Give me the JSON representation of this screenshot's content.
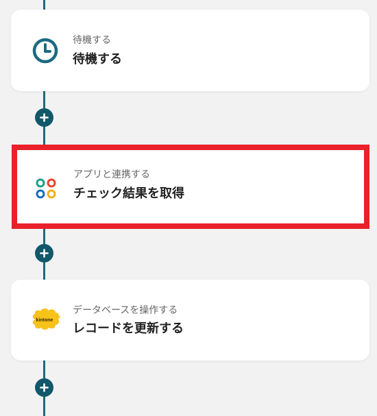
{
  "steps": [
    {
      "category": "待機する",
      "title": "待機する",
      "icon": "clock-icon"
    },
    {
      "category": "アプリと連携する",
      "title": "チェック結果を取得",
      "icon": "app-integration-icon"
    },
    {
      "category": "データベースを操作する",
      "title": "レコードを更新する",
      "icon": "kintone-logo-icon",
      "logo_text": "kintone"
    }
  ],
  "colors": {
    "flow_line": "#1c6a7a",
    "add_button": "#12586b",
    "highlight_border": "#e8212a",
    "clock": "#1a6b80",
    "kintone_yellow": "#f7c31a"
  }
}
